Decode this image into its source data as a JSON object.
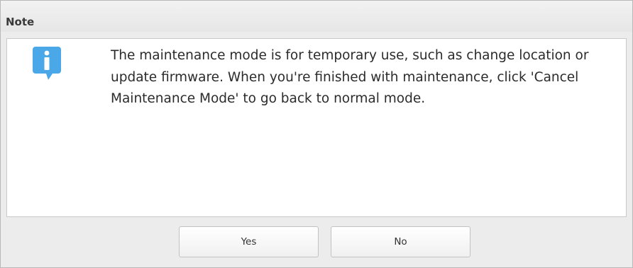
{
  "dialog": {
    "title": "Note",
    "icon": "info-icon",
    "accent_color": "#4aa8e8",
    "message": "The maintenance mode is for temporary use, such as change location or update firmware. When you're finished with maintenance, click 'Cancel Maintenance Mode' to go back to normal mode.",
    "buttons": {
      "yes_label": "Yes",
      "no_label": "No"
    }
  }
}
